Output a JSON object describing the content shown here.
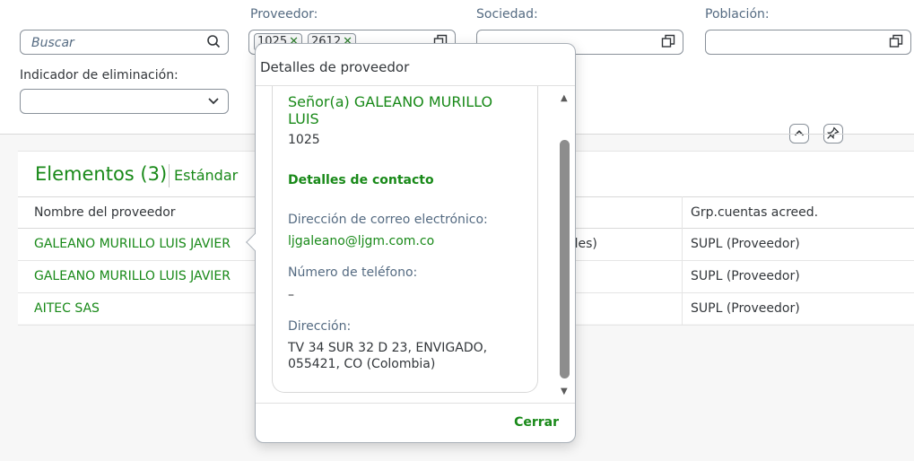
{
  "filters": {
    "search": {
      "placeholder": "Buscar"
    },
    "supplier": {
      "label": "Proveedor:",
      "tokens": [
        "1025",
        "2612"
      ]
    },
    "company": {
      "label": "Sociedad:"
    },
    "city": {
      "label": "Población:"
    },
    "deletion": {
      "label": "Indicador de eliminación:"
    }
  },
  "table": {
    "title": "Elementos (3)",
    "variant": "Estándar",
    "columns": [
      "Nombre del proveedor",
      "Grp.cuentas acreed."
    ],
    "rows": [
      {
        "name": "GALEANO MURILLO LUIS JAVIER",
        "middle": "ales)",
        "group": "SUPL (Proveedor)"
      },
      {
        "name": "GALEANO MURILLO LUIS JAVIER",
        "middle": "",
        "group": "SUPL (Proveedor)"
      },
      {
        "name": "AITEC SAS",
        "middle": "",
        "group": "SUPL (Proveedor)"
      }
    ]
  },
  "popover": {
    "title": "Detalles de proveedor",
    "name": "Señor(a) GALEANO MURILLO LUIS",
    "id": "1025",
    "contact_section": "Detalles de contacto",
    "email_label": "Dirección de correo electrónico:",
    "email": "ljgaleano@ljgm.com.co",
    "phone_label": "Número de teléfono:",
    "phone": "–",
    "address_label": "Dirección:",
    "address": "TV 34 SUR 32 D 23, ENVIGADO, 055421, CO (Colombia)",
    "close_label": "Cerrar"
  },
  "colors": {
    "accent": "#188918",
    "text": "#32363a",
    "label": "#556b82",
    "border": "#89919a"
  },
  "icons": [
    "search-icon",
    "value-help-icon",
    "chevron-down-icon",
    "collapse-icon",
    "pin-icon",
    "scroll-up-icon",
    "scroll-down-icon"
  ]
}
